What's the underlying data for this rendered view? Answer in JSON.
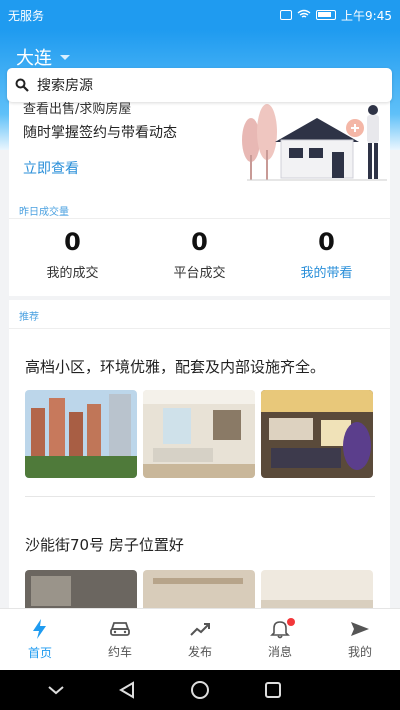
{
  "status": {
    "carrier": "无服务",
    "time": "上午9:45"
  },
  "header": {
    "city": "大连"
  },
  "search": {
    "placeholder": "搜索房源"
  },
  "banner": {
    "line1": "查看出售/求购房屋",
    "line2": "随时掌握签约与带看动态",
    "link": "立即查看"
  },
  "stats": {
    "section_label": "昨日成交量",
    "items": [
      {
        "value": "0",
        "label": "我的成交"
      },
      {
        "value": "0",
        "label": "平台成交"
      },
      {
        "value": "0",
        "label": "我的带看"
      }
    ]
  },
  "recommend": {
    "section_label": "推荐",
    "cards": [
      {
        "title": "高档小区，环境优雅，配套及内部设施齐全。"
      },
      {
        "title": "沙能街70号 房子位置好"
      }
    ]
  },
  "tabbar": {
    "items": [
      {
        "label": "首页",
        "icon": "lightning-icon"
      },
      {
        "label": "约车",
        "icon": "car-icon"
      },
      {
        "label": "发布",
        "icon": "trend-icon"
      },
      {
        "label": "消息",
        "icon": "bell-icon"
      },
      {
        "label": "我的",
        "icon": "send-icon"
      }
    ]
  },
  "colors": {
    "primary": "#1f9bf0",
    "link": "#2a8fd9",
    "badge": "#f2373a"
  }
}
